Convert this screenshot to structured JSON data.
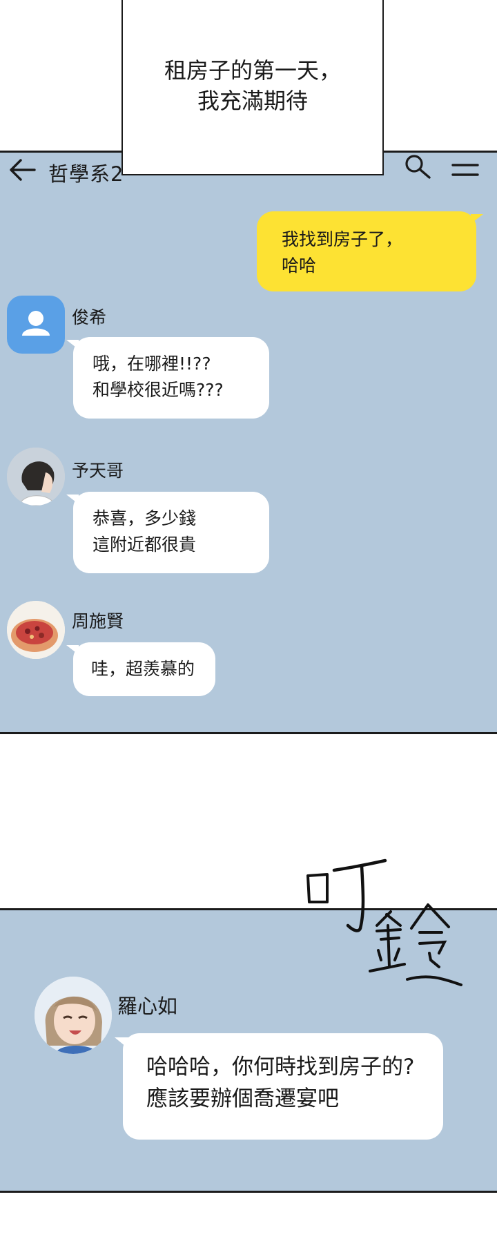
{
  "caption": {
    "text": "租房子的第一天，\n我充滿期待"
  },
  "chat_header": {
    "title": "哲學系2",
    "back_icon": "arrow-left-icon",
    "search_icon": "search-icon",
    "menu_icon": "hamburger-menu-icon"
  },
  "outgoing_message": {
    "text": "我找到房子了，\n哈哈"
  },
  "messages": [
    {
      "sender": "俊希",
      "text": "哦，在哪裡!!??\n和學校很近嗎???",
      "avatar": "default-user-avatar"
    },
    {
      "sender": "予天哥",
      "text": "恭喜，多少錢\n這附近都很貴",
      "avatar": "man-back-of-head-avatar"
    },
    {
      "sender": "周施賢",
      "text": "哇，超羨慕的",
      "avatar": "food-bowl-avatar"
    }
  ],
  "sfx": {
    "text": "叮鈴"
  },
  "second_chat": {
    "sender": "羅心如",
    "text": "哈哈哈，你何時找到房子的?\n應該要辦個喬遷宴吧",
    "avatar": "smiling-woman-avatar"
  },
  "colors": {
    "chat_background": "#b3c8db",
    "outgoing_bubble": "#fde233",
    "incoming_bubble": "#ffffff",
    "default_avatar": "#5aa0e6"
  }
}
